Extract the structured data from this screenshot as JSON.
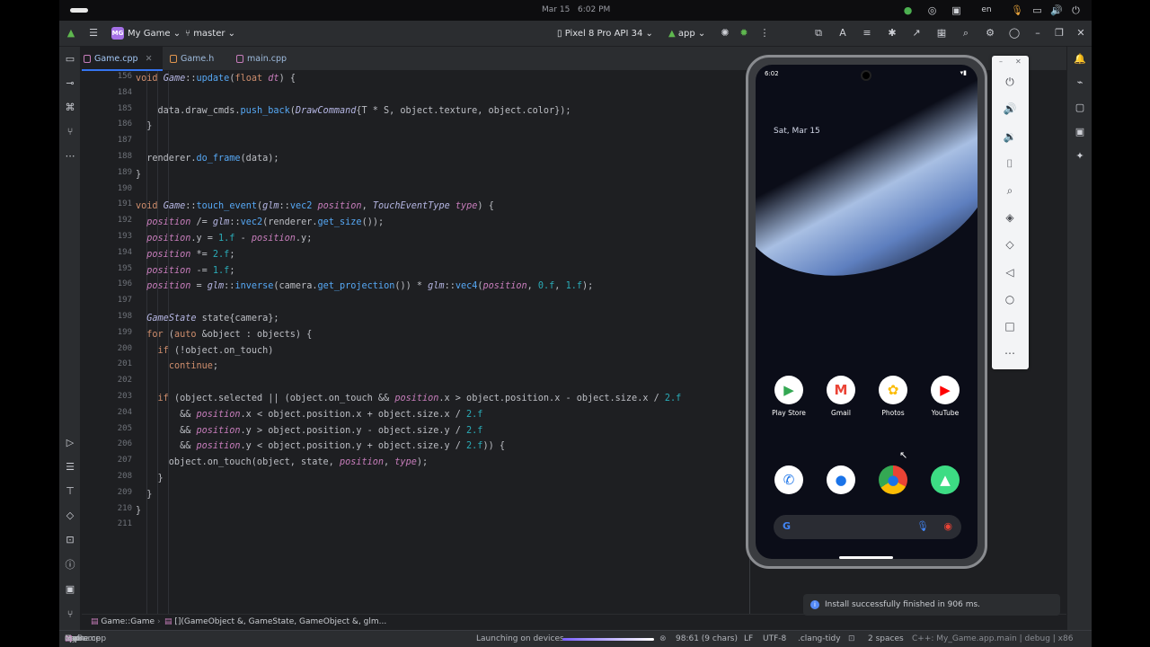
{
  "system_bar": {
    "date": "Mar 15",
    "time": "6:02 PM",
    "lang": "en"
  },
  "toolbar": {
    "project_initials": "MG",
    "project_name": "My Game",
    "branch": "master",
    "device": "Pixel 8 Pro API 34",
    "run_config": "app"
  },
  "tabs": [
    {
      "label": "Game.cpp",
      "active": true
    },
    {
      "label": "Game.h",
      "active": false
    },
    {
      "label": "main.cpp",
      "active": false
    }
  ],
  "code": {
    "line_numbers": [
      "156",
      "184",
      "185",
      "186",
      "187",
      "188",
      "189",
      "190",
      "191",
      "192",
      "193",
      "194",
      "195",
      "196",
      "197",
      "198",
      "199",
      "200",
      "201",
      "202",
      "203",
      "204",
      "205",
      "206",
      "207",
      "208",
      "209",
      "210",
      "211"
    ],
    "lines": [
      "void Game::update(float dt) {",
      "",
      "    data.draw_cmds.push_back(DrawCommand{T * S, object.texture, object.color});",
      "  }",
      "",
      "  renderer.do_frame(data);",
      "}",
      "",
      "void Game::touch_event(glm::vec2 position, TouchEventType type) {",
      "  position /= glm::vec2(renderer.get_size());",
      "  position.y = 1.f - position.y;",
      "  position *= 2.f;",
      "  position -= 1.f;",
      "  position = glm::inverse(camera.get_projection()) * glm::vec4(position, 0.f, 1.f);",
      "",
      "  GameState state{camera};",
      "  for (auto &object : objects) {",
      "    if (!object.on_touch)",
      "      continue;",
      "",
      "    if (object.selected || (object.on_touch && position.x > object.position.x - object.size.x / 2.f",
      "        && position.x < object.position.x + object.size.x / 2.f",
      "        && position.y > object.position.y - object.size.y / 2.f",
      "        && position.y < object.position.y + object.size.y / 2.f)) {",
      "      object.on_touch(object, state, position, type);",
      "    }",
      "  }",
      "}",
      ""
    ]
  },
  "breadcrumb": {
    "item1": "Game::Game",
    "item2": "[](GameObject &, GameState, GameObject &, glm..."
  },
  "status": {
    "path": [
      "MyGame",
      "app",
      "src",
      "main",
      "cpp",
      "Game.cpp"
    ],
    "task": "Launching on devices",
    "position": "98:61 (9 chars)",
    "line_sep": "LF",
    "encoding": "UTF-8",
    "linter": ".clang-tidy",
    "indent": "2 spaces",
    "context": "C++: My_Game.app.main | debug | x86"
  },
  "toast": {
    "message": "Install successfully finished in 906 ms."
  },
  "phone": {
    "time": "6:02",
    "date": "Sat, Mar 15",
    "apps_row1": [
      "Play Store",
      "Gmail",
      "Photos",
      "YouTube"
    ]
  },
  "colors": {
    "accent": "#3574f0",
    "editor_bg": "#1e1f22",
    "panel_bg": "#2b2d30"
  }
}
